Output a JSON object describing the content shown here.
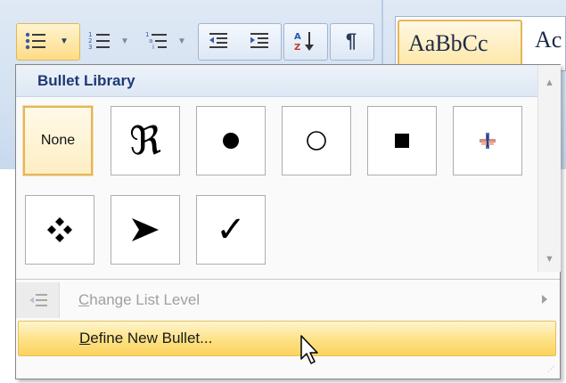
{
  "ribbon": {
    "styles": {
      "normal_preview": "AaBbCc",
      "next_preview": "Ac"
    }
  },
  "bullet_menu": {
    "header": "Bullet Library",
    "cells": [
      {
        "label": "None",
        "selected": true
      },
      {
        "symbol": "ℜ",
        "icon": "fraktur-r-bullet-icon"
      },
      {
        "symbol": "●",
        "icon": "filled-circle-bullet-icon"
      },
      {
        "symbol": "○",
        "icon": "hollow-circle-bullet-icon"
      },
      {
        "symbol": "■",
        "icon": "filled-square-bullet-icon"
      },
      {
        "icon": "picture-bullet-icon"
      },
      {
        "symbol": "❖",
        "icon": "diamond-cluster-bullet-icon"
      },
      {
        "symbol": "➤",
        "icon": "arrowhead-bullet-icon"
      },
      {
        "symbol": "✓",
        "icon": "checkmark-bullet-icon"
      }
    ],
    "change_level": {
      "prefix": "",
      "accel": "C",
      "rest": "hange List Level",
      "enabled": false
    },
    "define_new": {
      "accel": "D",
      "rest": "efine New Bullet..."
    }
  },
  "colors": {
    "header_text": "#1e3a74",
    "highlight": "#fde38a",
    "selected_border": "#e5b55a"
  }
}
